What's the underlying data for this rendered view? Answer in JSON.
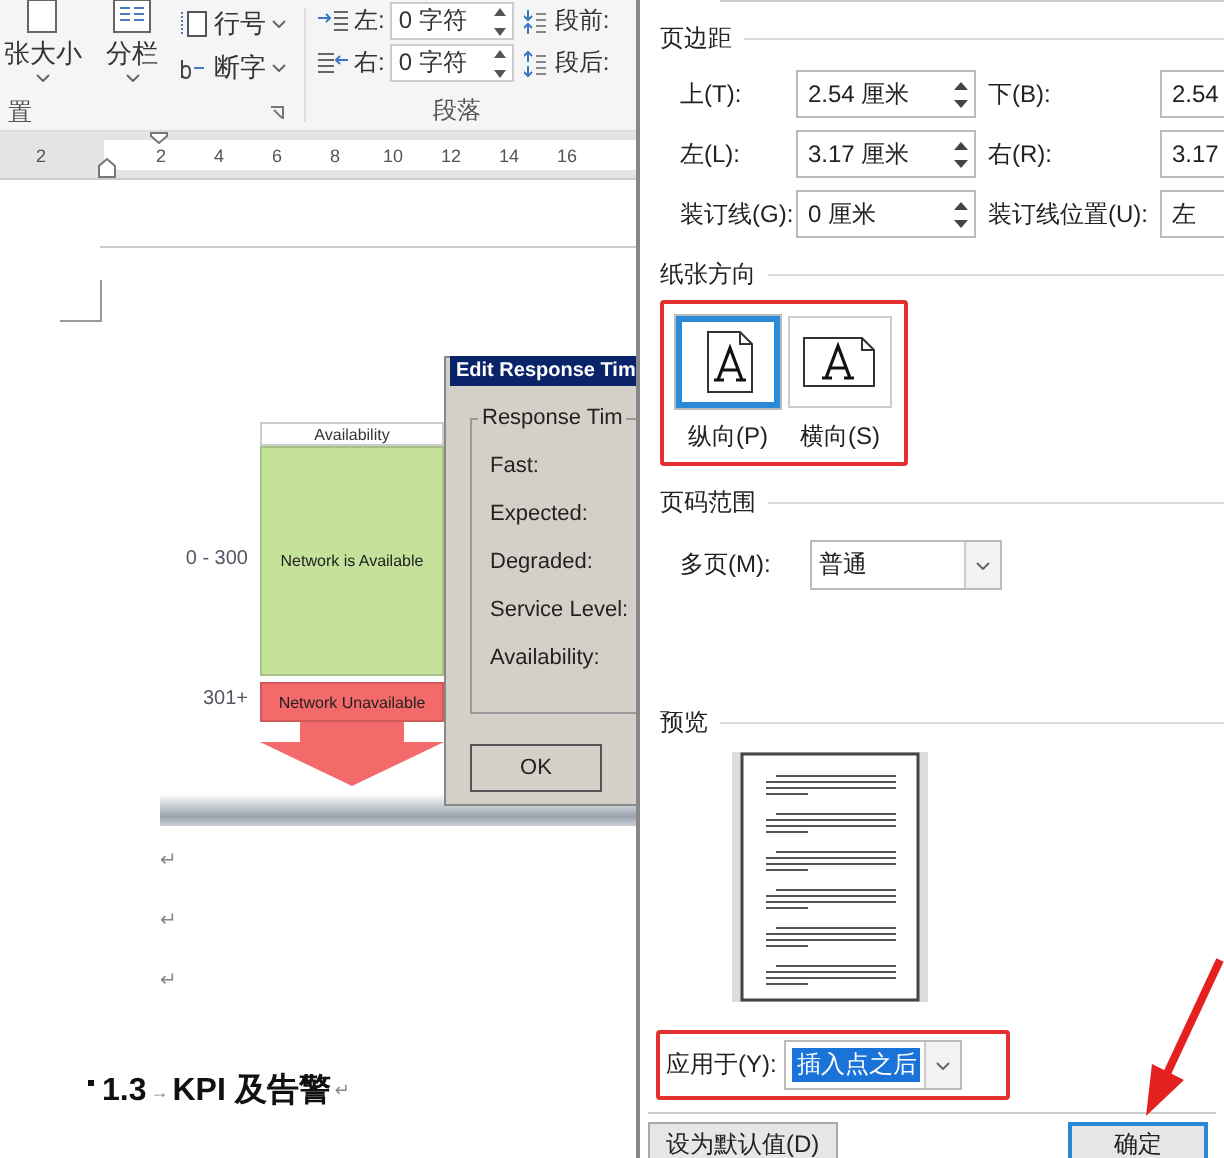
{
  "ribbon": {
    "page_setup": {
      "buttons": [
        {
          "label": "张大小",
          "kind": "size"
        },
        {
          "label": "分栏",
          "kind": "columns"
        }
      ],
      "menu_items": [
        {
          "label": "行号",
          "kind": "line-numbers"
        },
        {
          "label": "断字",
          "kind": "hyphenation"
        }
      ],
      "group_label": "置"
    },
    "paragraph": {
      "indents": [
        {
          "label": "左:",
          "value": "0 字符",
          "kind": "left"
        },
        {
          "label": "右:",
          "value": "0 字符",
          "kind": "right"
        }
      ],
      "spacing": [
        {
          "label": "段前:",
          "kind": "before"
        },
        {
          "label": "段后:",
          "kind": "after"
        }
      ],
      "group_label": "段落"
    }
  },
  "ruler": {
    "labels": [
      "2",
      "2",
      "4",
      "6",
      "8",
      "10",
      "12",
      "14",
      "16"
    ]
  },
  "document": {
    "figure": {
      "column_header": "Availability",
      "bands": [
        {
          "range": "0 - 300",
          "label": "Network is Available",
          "color": "#c5e29b"
        },
        {
          "range": "301+",
          "label": "Network Unavailable",
          "color": "#f46a6a"
        }
      ],
      "dialog": {
        "title": "Edit Response Tim",
        "group": "Response Tim",
        "fields": [
          "Fast:",
          "Expected:",
          "Degraded:",
          "Service Level:",
          "Availability:"
        ],
        "button": "OK"
      }
    },
    "paragraph_marks": [
      "↵",
      "↵",
      "↵"
    ],
    "heading": {
      "number": "1.3",
      "tab_mark": "→",
      "text": "KPI 及告警",
      "paragraph_mark": "↵"
    }
  },
  "dialog": {
    "margins": {
      "title": "页边距",
      "fields": [
        {
          "label": "上(T):",
          "value": "2.54 厘米",
          "kind": "spinner"
        },
        {
          "label": "下(B):",
          "value": "2.54",
          "kind": "spinner"
        },
        {
          "label": "左(L):",
          "value": "3.17 厘米",
          "kind": "spinner"
        },
        {
          "label": "右(R):",
          "value": "3.17",
          "kind": "spinner"
        },
        {
          "label": "装订线(G):",
          "value": "0 厘米",
          "kind": "spinner"
        },
        {
          "label": "装订线位置(U):",
          "value": "左",
          "kind": "select"
        }
      ]
    },
    "orientation": {
      "title": "纸张方向",
      "highlighted": true,
      "options": [
        {
          "label": "纵向(P)",
          "kind": "portrait",
          "selected": true
        },
        {
          "label": "横向(S)",
          "kind": "landscape",
          "selected": false
        }
      ]
    },
    "pages": {
      "title": "页码范围",
      "label": "多页(M):",
      "value": "普通"
    },
    "preview": {
      "title": "预览"
    },
    "apply_to": {
      "label": "应用于(Y):",
      "value": "插入点之后",
      "value_selected": true,
      "highlighted": true
    },
    "buttons": [
      {
        "label": "设为默认值(D)",
        "kind": "secondary"
      },
      {
        "label": "确定",
        "kind": "default"
      }
    ]
  }
}
